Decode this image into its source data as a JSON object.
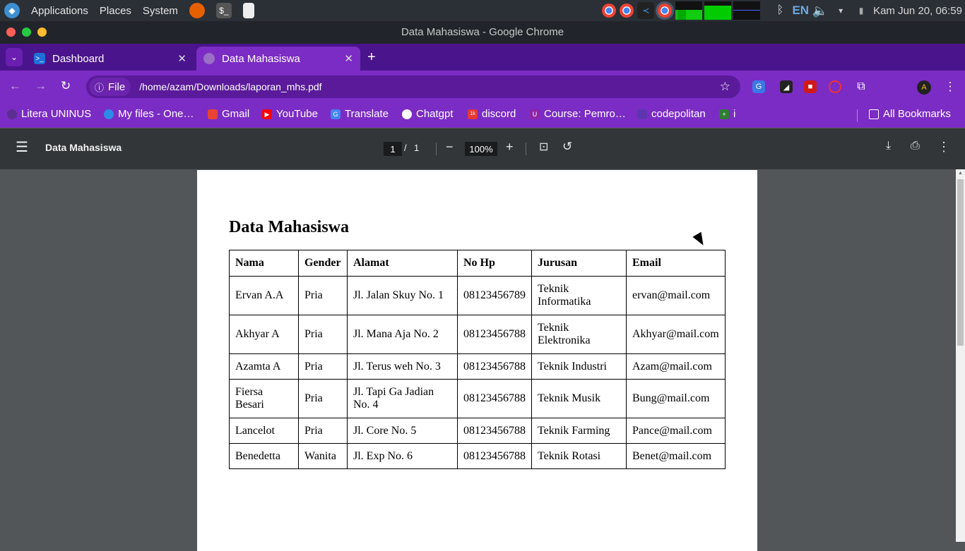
{
  "topbar": {
    "menus": [
      "Applications",
      "Places",
      "System"
    ],
    "lang": "EN",
    "clock": "Kam Jun 20, 06:59"
  },
  "window": {
    "title": "Data Mahasiswa - Google Chrome"
  },
  "tabs": [
    {
      "label": "Dashboard",
      "active": false
    },
    {
      "label": "Data Mahasiswa",
      "active": true
    }
  ],
  "omnibox": {
    "chip": "File",
    "url": "/home/azam/Downloads/laporan_mhs.pdf"
  },
  "bookmarks": {
    "items": [
      "Litera UNINUS",
      "My files - One…",
      "Gmail",
      "YouTube",
      "Translate",
      "Chatgpt",
      "discord",
      "Course: Pemro…",
      "codepolitan",
      "i"
    ],
    "all_label": "All Bookmarks"
  },
  "pdf": {
    "title": "Data Mahasiswa",
    "page_current": "1",
    "page_sep": "/",
    "page_total": "1",
    "zoom": "100%"
  },
  "doc": {
    "heading": "Data Mahasiswa",
    "headers": [
      "Nama",
      "Gender",
      "Alamat",
      "No Hp",
      "Jurusan",
      "Email"
    ],
    "rows": [
      [
        "Ervan A.A",
        "Pria",
        "Jl. Jalan Skuy No. 1",
        "08123456789",
        "Teknik Informatika",
        "ervan@mail.com"
      ],
      [
        "Akhyar A",
        "Pria",
        "Jl. Mana Aja No. 2",
        "08123456788",
        "Teknik Elektronika",
        "Akhyar@mail.com"
      ],
      [
        "Azamta A",
        "Pria",
        "Jl. Terus weh No. 3",
        "08123456788",
        "Teknik Industri",
        "Azam@mail.com"
      ],
      [
        "Fiersa Besari",
        "Pria",
        "Jl. Tapi Ga Jadian No. 4",
        "08123456788",
        "Teknik Musik",
        "Bung@mail.com"
      ],
      [
        "Lancelot",
        "Pria",
        "Jl. Core No. 5",
        "08123456788",
        "Teknik Farming",
        "Pance@mail.com"
      ],
      [
        "Benedetta",
        "Wanita",
        "Jl. Exp No. 6",
        "08123456788",
        "Teknik Rotasi",
        "Benet@mail.com"
      ]
    ]
  }
}
